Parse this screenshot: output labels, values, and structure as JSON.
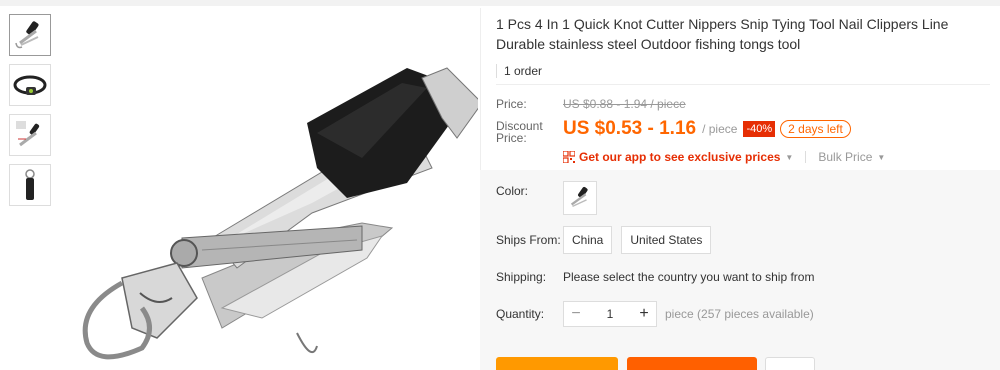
{
  "product": {
    "title": "1 Pcs 4 In 1 Quick Knot Cutter Nippers Snip Tying Tool Nail Clippers Line Durable stainless steel Outdoor fishing tongs tool",
    "orders": "1 order"
  },
  "price": {
    "label": "Price:",
    "original": "US $0.88 - 1.94 / piece",
    "discount_label_1": "Discount",
    "discount_label_2": "Price:",
    "discount": "US $0.53 - 1.16",
    "per": "/ piece",
    "off_badge": "-40%",
    "days_left": "2 days left"
  },
  "promo": {
    "app_link": "Get our app to see exclusive prices",
    "bulk": "Bulk Price"
  },
  "options": {
    "color_label": "Color:",
    "ships_from_label": "Ships From:",
    "ships_from": [
      "China",
      "United States"
    ],
    "shipping_label": "Shipping:",
    "shipping_text": "Please select the country you want to ship from",
    "quantity_label": "Quantity:",
    "quantity_value": "1",
    "quantity_note": "piece (257 pieces available)",
    "minus": "−",
    "plus": "+"
  },
  "thumbnails": [
    "nail-clipper-tool",
    "headlamp",
    "clipper-tool-set",
    "clipper-keychain"
  ],
  "icons": [
    "qr-code-icon",
    "chevron-down-icon"
  ],
  "colors": {
    "accent": "#ff6600",
    "badge": "#e62e04",
    "buy": "#ff9900",
    "cart": "#ff6000"
  }
}
